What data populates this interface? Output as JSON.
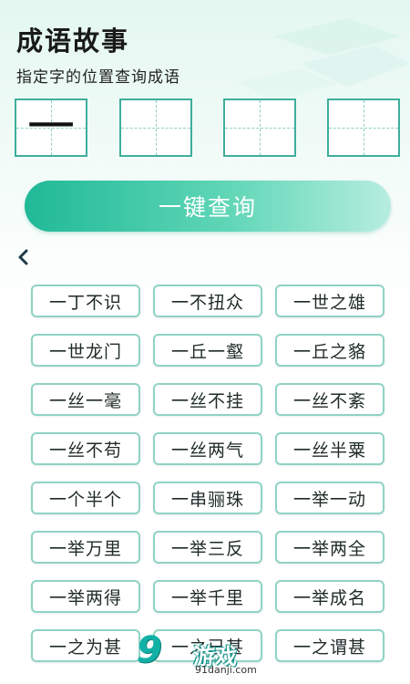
{
  "header": {
    "title": "成语故事",
    "subtitle": "指定字的位置查询成语"
  },
  "char_boxes": [
    "一",
    "",
    "",
    ""
  ],
  "query_button": {
    "label": "一键查询"
  },
  "back_button": {
    "icon": "chevron-left-icon"
  },
  "idioms": [
    "一丁不识",
    "一不扭众",
    "一世之雄",
    "一世龙门",
    "一丘一壑",
    "一丘之貉",
    "一丝一毫",
    "一丝不挂",
    "一丝不紊",
    "一丝不苟",
    "一丝两气",
    "一丝半粟",
    "一个半个",
    "一串骊珠",
    "一举一动",
    "一举万里",
    "一举三反",
    "一举两全",
    "一举两得",
    "一举千里",
    "一举成名",
    "一之为甚",
    "一之已甚",
    "一之谓甚"
  ],
  "watermark": {
    "number": "9",
    "text": "游戏",
    "site": "91danji.com"
  },
  "colors": {
    "accent": "#20b997",
    "chip_border": "#8fd3c4",
    "box_border": "#3fae9c"
  }
}
